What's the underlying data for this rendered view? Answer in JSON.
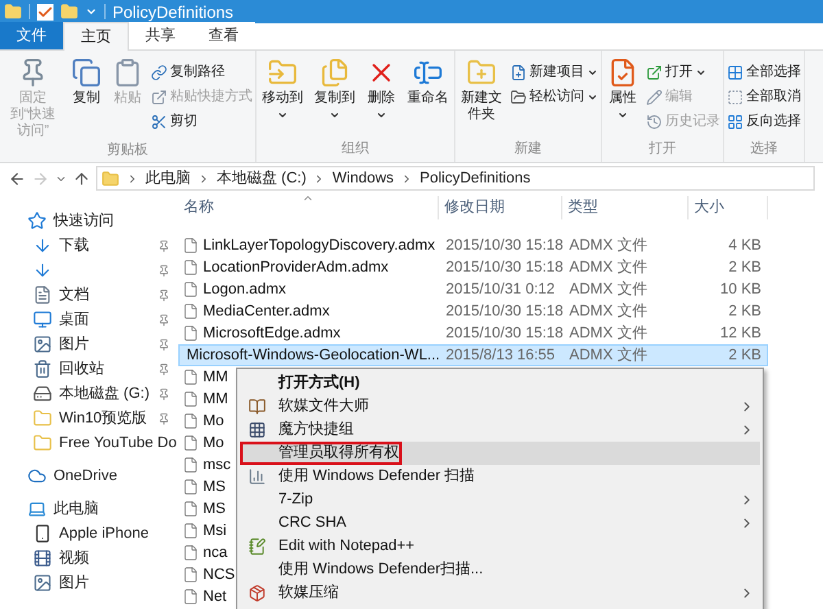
{
  "window": {
    "title": "PolicyDefinitions"
  },
  "ribbon_tabs": [
    {
      "label": "文件",
      "kind": "file",
      "selected": false
    },
    {
      "label": "主页",
      "kind": "tab",
      "selected": true
    },
    {
      "label": "共享",
      "kind": "tab",
      "selected": false
    },
    {
      "label": "查看",
      "kind": "tab",
      "selected": false
    }
  ],
  "ribbon_groups": [
    {
      "label": "剪贴板",
      "large": [
        {
          "label": "固定到“快速访问”",
          "disabled": true,
          "menu": false
        },
        {
          "label": "复制",
          "disabled": false,
          "menu": false
        },
        {
          "label": "粘贴",
          "disabled": true,
          "menu": false
        }
      ],
      "small": [
        {
          "label": "复制路径",
          "disabled": false,
          "menu": false
        },
        {
          "label": "粘贴快捷方式",
          "disabled": true,
          "menu": false
        },
        {
          "label": "剪切",
          "disabled": false,
          "menu": false
        }
      ]
    },
    {
      "label": "组织",
      "large": [
        {
          "label": "移动到",
          "disabled": false,
          "menu": true
        },
        {
          "label": "复制到",
          "disabled": false,
          "menu": true
        },
        {
          "label": "删除",
          "disabled": false,
          "menu": true
        },
        {
          "label": "重命名",
          "disabled": false,
          "menu": false
        }
      ]
    },
    {
      "label": "新建",
      "large": [
        {
          "label": "新建文件夹",
          "disabled": false,
          "menu": false
        }
      ],
      "small": [
        {
          "label": "新建项目",
          "disabled": false,
          "menu": true
        },
        {
          "label": "轻松访问",
          "disabled": false,
          "menu": true
        }
      ]
    },
    {
      "label": "打开",
      "large": [
        {
          "label": "属性",
          "disabled": false,
          "menu": true
        }
      ],
      "small": [
        {
          "label": "打开",
          "disabled": false,
          "menu": true
        },
        {
          "label": "编辑",
          "disabled": true,
          "menu": false
        },
        {
          "label": "历史记录",
          "disabled": true,
          "menu": false
        }
      ]
    },
    {
      "label": "选择",
      "small": [
        {
          "label": "全部选择",
          "disabled": false,
          "menu": false
        },
        {
          "label": "全部取消",
          "disabled": false,
          "menu": false
        },
        {
          "label": "反向选择",
          "disabled": false,
          "menu": false
        }
      ]
    }
  ],
  "address_bar": {
    "forward_disabled": true,
    "path": [
      "此电脑",
      "本地磁盘 (C:)",
      "Windows",
      "PolicyDefinitions"
    ]
  },
  "sidebar": [
    {
      "label": "快速访问",
      "kind": "star",
      "children": [
        {
          "label": "下载",
          "kind": "download",
          "pinned": true
        },
        {
          "kind": "download",
          "pinned": true
        },
        {
          "label": "文档",
          "kind": "document",
          "pinned": true
        },
        {
          "label": "桌面",
          "kind": "desktop",
          "pinned": true
        },
        {
          "label": "图片",
          "kind": "picture",
          "pinned": true
        },
        {
          "label": "回收站",
          "kind": "recycle",
          "pinned": true
        },
        {
          "label": "本地磁盘 (G:)",
          "kind": "drive",
          "pinned": true
        },
        {
          "label": "Win10预览版",
          "kind": "folder",
          "pinned": true
        },
        {
          "label": "Free YouTube Do",
          "kind": "folder",
          "pinned": false
        }
      ]
    },
    {
      "label": "OneDrive",
      "kind": "cloud"
    },
    {
      "label": "此电脑",
      "kind": "computer",
      "children": [
        {
          "label": "Apple iPhone",
          "kind": "phone",
          "pinned": false
        },
        {
          "label": "视频",
          "kind": "video",
          "pinned": false
        },
        {
          "label": "图片",
          "kind": "picture",
          "pinned": false
        }
      ]
    }
  ],
  "file_table": {
    "columns": [
      "名称",
      "修改日期",
      "类型",
      "大小"
    ],
    "rows": [
      {
        "name": "LinkLayerTopologyDiscovery.admx",
        "date": "2015/10/30 15:18",
        "type": "ADMX 文件",
        "size": "4 KB",
        "selected": false
      },
      {
        "name": "LocationProviderAdm.admx",
        "date": "2015/10/30 15:18",
        "type": "ADMX 文件",
        "size": "2 KB",
        "selected": false
      },
      {
        "name": "Logon.admx",
        "date": "2015/10/31 0:12",
        "type": "ADMX 文件",
        "size": "10 KB",
        "selected": false
      },
      {
        "name": "MediaCenter.admx",
        "date": "2015/10/30 15:18",
        "type": "ADMX 文件",
        "size": "2 KB",
        "selected": false
      },
      {
        "name": "MicrosoftEdge.admx",
        "date": "2015/10/30 15:18",
        "type": "ADMX 文件",
        "size": "12 KB",
        "selected": false
      },
      {
        "name": "Microsoft-Windows-Geolocation-WL...",
        "date": "2015/8/13 16:55",
        "type": "ADMX 文件",
        "size": "2 KB",
        "selected": true
      },
      {
        "name": "MM",
        "selected": false
      },
      {
        "name": "MM",
        "selected": false
      },
      {
        "name": "Mo",
        "selected": false
      },
      {
        "name": "Mo",
        "selected": false
      },
      {
        "name": "msc",
        "selected": false
      },
      {
        "name": "MS",
        "selected": false
      },
      {
        "name": "MS",
        "selected": false
      },
      {
        "name": "Msi",
        "selected": false
      },
      {
        "name": "nca",
        "selected": false
      },
      {
        "name": "NCS",
        "selected": false
      },
      {
        "name": "Net",
        "selected": false
      }
    ]
  },
  "context_menu": [
    {
      "label": "打开方式(H)",
      "kind": "plain",
      "default": true,
      "submenu": false,
      "selected": false,
      "marked": false
    },
    {
      "label": "软媒文件大师",
      "kind": "book",
      "default": false,
      "submenu": true,
      "selected": false,
      "marked": false
    },
    {
      "label": "魔方快捷组",
      "kind": "grid",
      "default": false,
      "submenu": true,
      "selected": false,
      "marked": false
    },
    {
      "label": "管理员取得所有权",
      "kind": "plain",
      "default": false,
      "submenu": false,
      "selected": true,
      "marked": true
    },
    {
      "label": "使用 Windows Defender 扫描",
      "kind": "chart",
      "default": false,
      "submenu": false,
      "selected": false,
      "marked": false
    },
    {
      "label": "7-Zip",
      "kind": "plain",
      "default": false,
      "submenu": true,
      "selected": false,
      "marked": false
    },
    {
      "label": "CRC SHA",
      "kind": "plain",
      "default": false,
      "submenu": true,
      "selected": false,
      "marked": false
    },
    {
      "label": "Edit with Notepad++",
      "kind": "notepad",
      "default": false,
      "submenu": false,
      "selected": false,
      "marked": false
    },
    {
      "label": "使用 Windows Defender扫描...",
      "kind": "plain",
      "default": false,
      "submenu": false,
      "selected": false,
      "marked": false
    },
    {
      "label": "软媒压缩",
      "kind": "package",
      "default": false,
      "submenu": true,
      "selected": false,
      "marked": false
    }
  ]
}
